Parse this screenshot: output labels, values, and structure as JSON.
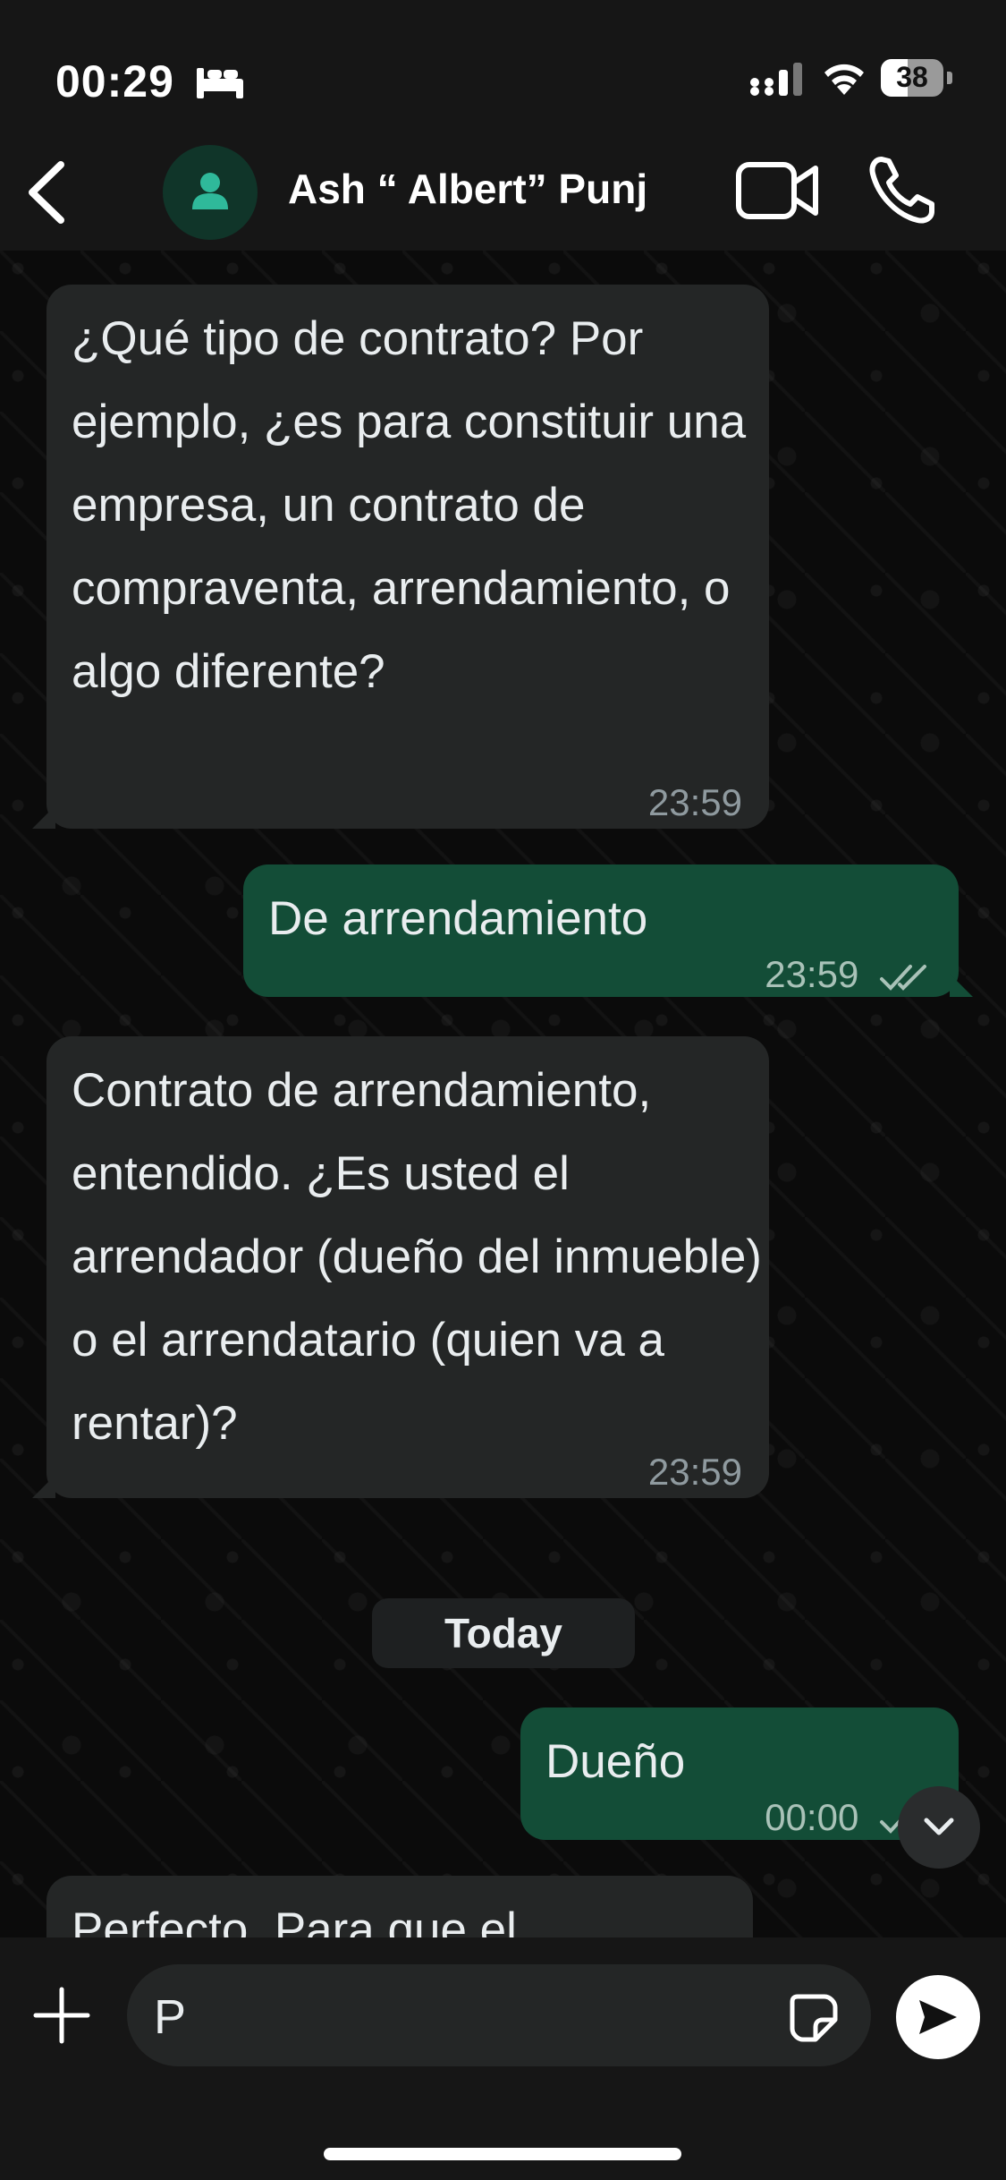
{
  "status_bar": {
    "time": "00:29",
    "battery": "38"
  },
  "header": {
    "contact_name": "Ash “ Albert” Punj"
  },
  "messages": [
    {
      "direction": "in",
      "text": "¿Qué tipo de contrato? Por ejemplo, ¿es para constituir una empresa, un contrato de compraventa, arrendamiento, o algo diferente?",
      "time": "23:59"
    },
    {
      "direction": "out",
      "text": "De arrendamiento",
      "time": "23:59",
      "status": "read"
    },
    {
      "direction": "in",
      "text": "Contrato de arrendamiento, entendido. ¿Es usted el arrendador (dueño del inmueble) o el arrendatario (quien va a rentar)?",
      "time": "23:59"
    },
    {
      "direction": "out",
      "text": "Dueño",
      "time": "00:00",
      "status": "delivered"
    },
    {
      "direction": "in",
      "text": "Perfecto. Para que el",
      "time": ""
    }
  ],
  "day_separator": "Today",
  "composer": {
    "input_value": "P"
  },
  "colors": {
    "incoming_bubble": "#242626",
    "outgoing_bubble": "#134d37",
    "avatar_icon": "#2fb99a"
  }
}
